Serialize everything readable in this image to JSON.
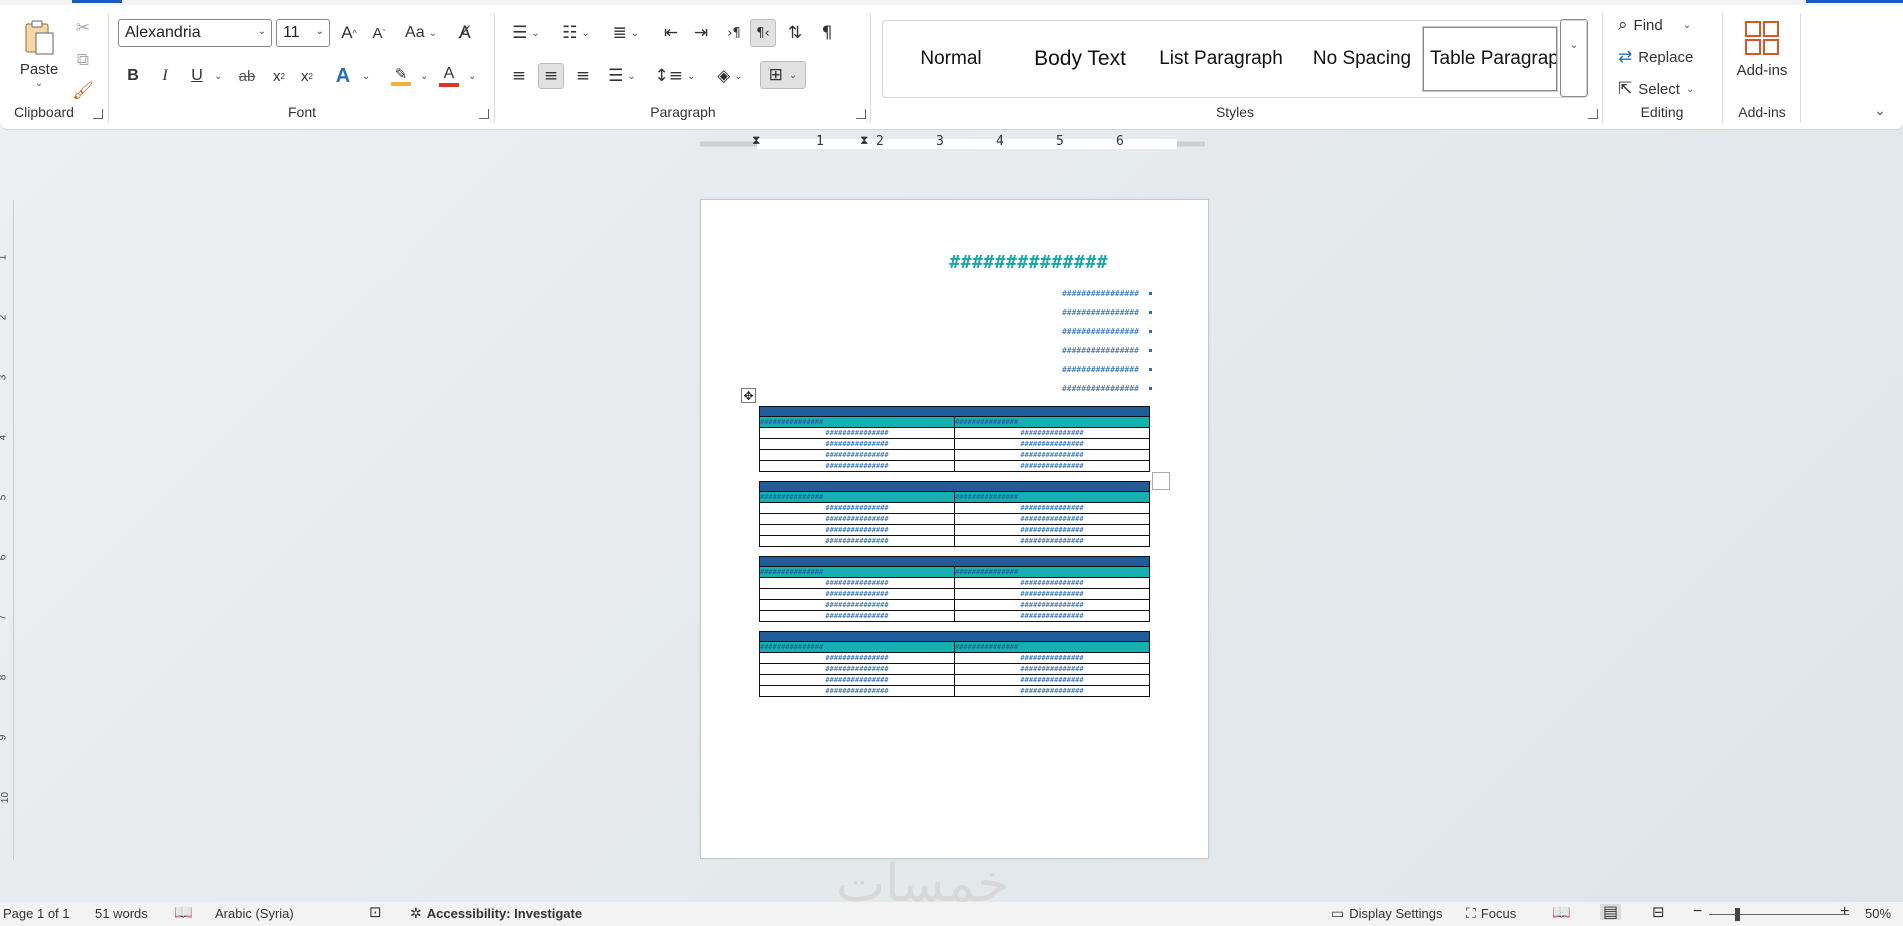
{
  "clipboard": {
    "paste_label": "Paste",
    "group_label": "Clipboard"
  },
  "font": {
    "family": "Alexandria",
    "size": "11",
    "group_label": "Font",
    "grow_label": "A",
    "shrink_label": "A",
    "case_label": "Aa",
    "bold": "B",
    "italic": "I",
    "underline": "U",
    "strike": "ab",
    "subscript": "x",
    "superscript": "x",
    "text_effects": "A",
    "font_color": "A"
  },
  "paragraph": {
    "group_label": "Paragraph"
  },
  "styles": {
    "group_label": "Styles",
    "items": [
      "Normal",
      "Body Text",
      "List Paragraph",
      "No Spacing",
      "Table Paragraph"
    ]
  },
  "editing": {
    "group_label": "Editing",
    "find": "Find",
    "replace": "Replace",
    "select": "Select"
  },
  "addins": {
    "label": "Add-ins",
    "group_label": "Add-ins"
  },
  "ruler": {
    "numbers": [
      "1",
      "2",
      "3",
      "4",
      "5",
      "6"
    ],
    "vertical_numbers": [
      "1",
      "2",
      "3",
      "4",
      "5",
      "6",
      "7",
      "8",
      "9",
      "10"
    ]
  },
  "document": {
    "title": "##############",
    "bullets": [
      "################",
      "################",
      "################",
      "################",
      "################",
      "################"
    ],
    "tables": [
      {
        "header": [
          "###############",
          "###############"
        ],
        "rows": [
          [
            "###############",
            "###############"
          ],
          [
            "###############",
            "###############"
          ],
          [
            "###############",
            "###############"
          ],
          [
            "###############",
            "###############"
          ]
        ]
      },
      {
        "header": [
          "###############",
          "###############"
        ],
        "rows": [
          [
            "###############",
            "###############"
          ],
          [
            "###############",
            "###############"
          ],
          [
            "###############",
            "###############"
          ],
          [
            "###############",
            "###############"
          ]
        ]
      },
      {
        "header": [
          "###############",
          "###############"
        ],
        "rows": [
          [
            "###############",
            "###############"
          ],
          [
            "###############",
            "###############"
          ],
          [
            "###############",
            "###############"
          ],
          [
            "###############",
            "###############"
          ]
        ]
      },
      {
        "header": [
          "###############",
          "###############"
        ],
        "rows": [
          [
            "###############",
            "###############"
          ],
          [
            "###############",
            "###############"
          ],
          [
            "###############",
            "###############"
          ],
          [
            "###############",
            "###############"
          ]
        ]
      }
    ]
  },
  "watermark": "خمسات",
  "status": {
    "page": "Page 1 of 1",
    "words": "51 words",
    "language": "Arabic (Syria)",
    "accessibility": "Accessibility: Investigate",
    "display_settings": "Display Settings",
    "focus": "Focus",
    "zoom": "50%"
  },
  "colors": {
    "accent": "#185abd",
    "title_teal": "#19a6a6",
    "table_top": "#1f5c99",
    "table_head": "#17b0b0",
    "text_blue": "#2a6db5"
  }
}
